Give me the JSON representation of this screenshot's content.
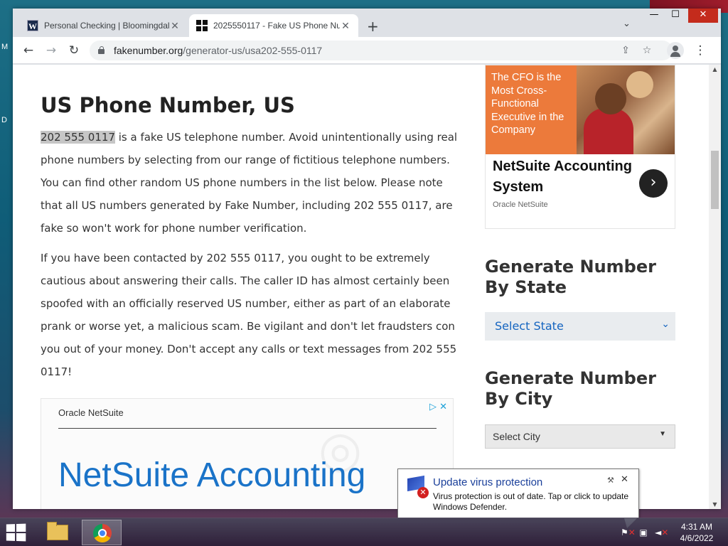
{
  "desktop": {
    "edge_letters": [
      "M",
      "D"
    ]
  },
  "browser": {
    "tabs": [
      {
        "title": "Personal Checking | Bloomingdal",
        "favicon": "w-icon",
        "active": false
      },
      {
        "title": "2025550117 - Fake US Phone Nu",
        "favicon": "grid-icon",
        "active": true
      }
    ],
    "new_tab_symbol": "+",
    "tab_search_symbol": "⌄",
    "window_controls": {
      "minimize": "—",
      "maximize": "☐",
      "close": "✕"
    },
    "nav": {
      "back": "←",
      "forward": "→",
      "reload": "↻"
    },
    "url_host": "fakenumber.org",
    "url_path": "/generator-us/usa202-555-0117",
    "omnibox_icons": [
      "share-icon",
      "star-icon"
    ],
    "menu_symbol": "⋮"
  },
  "page": {
    "title": "US Phone Number, US",
    "para1_highlight": "202 555 0117",
    "para1_rest": " is a fake US telephone number. Avoid unintentionally using real phone numbers by selecting from our range of fictitious telephone numbers. You can find other random US phone numbers in the list below. Please note that all US numbers generated by Fake Number, including 202 555 0117, are fake so won't work for phone number verification.",
    "para2": "If you have been contacted by 202 555 0117, you ought to be extremely cautious about answering their calls. The caller ID has almost certainly been spoofed with an officially reserved US number, either as part of an elaborate prank or worse yet, a malicious scam. Be vigilant and don't let fraudsters con you out of your money. Don't accept any calls or text messages from 202 555 0117!",
    "inline_ad": {
      "brand": "Oracle NetSuite",
      "headline": "NetSuite Accounting",
      "adchoices": "▷ ✕"
    },
    "side_ad": {
      "image_caption": "The CFO is the Most Cross-Functional Executive in the Company",
      "title": "NetSuite Accounting System",
      "source": "Oracle NetSuite",
      "arrow": "›"
    },
    "state_heading": "Generate Number By State",
    "state_select": "Select State",
    "city_heading": "Generate Number By City",
    "city_select": "Select City"
  },
  "notification": {
    "title": "Update virus protection",
    "message": "Virus protection is out of date. Tap or click to update Windows Defender.",
    "close": "✕"
  },
  "taskbar": {
    "time": "4:31 AM",
    "date": "4/6/2022",
    "apps": [
      "file-explorer",
      "chrome"
    ]
  },
  "colors": {
    "link_blue": "#1565c0",
    "ad_orange": "#ec7a3b",
    "netsuite_blue": "#1a73c8",
    "close_red": "#c42b1c"
  }
}
